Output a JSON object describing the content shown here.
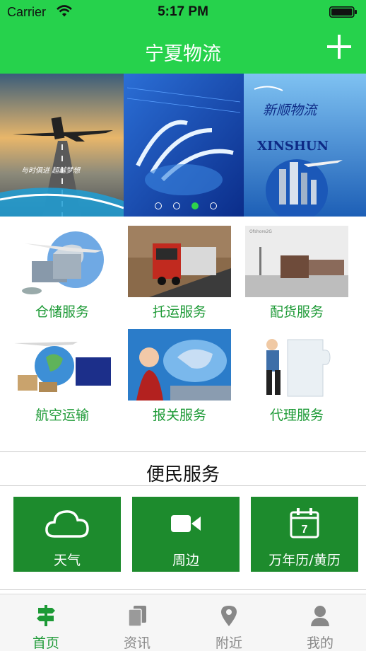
{
  "status_bar": {
    "carrier": "Carrier",
    "time": "5:17 PM"
  },
  "nav": {
    "title": "宁夏物流",
    "add_icon": "plus-icon"
  },
  "banner": {
    "left_caption": "与时俱进 超越梦想",
    "brand_cn": "新顺物流",
    "brand_en": "XINSHUN",
    "page_count": 4,
    "active_page": 3
  },
  "services": [
    {
      "label": "仓储服务",
      "image": "warehouse-globe"
    },
    {
      "label": "托运服务",
      "image": "truck-on-road"
    },
    {
      "label": "配货服务",
      "image": "train-freight",
      "image_caption": "Ofshore2G"
    },
    {
      "label": "航空运输",
      "image": "air-cargo-globe"
    },
    {
      "label": "报关服务",
      "image": "stewardess-world-map"
    },
    {
      "label": "代理服务",
      "image": "man-pushing-puzzle"
    }
  ],
  "convenience": {
    "title": "便民服务",
    "items": [
      {
        "label": "天气",
        "icon": "cloud-icon"
      },
      {
        "label": "周边",
        "icon": "video-camera-icon"
      },
      {
        "label": "万年历/黄历",
        "icon": "calendar-icon",
        "icon_text": "7"
      }
    ]
  },
  "tabs": [
    {
      "label": "首页",
      "icon": "signpost-icon",
      "active": true
    },
    {
      "label": "资讯",
      "icon": "documents-icon",
      "active": false
    },
    {
      "label": "附近",
      "icon": "map-pin-icon",
      "active": false
    },
    {
      "label": "我的",
      "icon": "user-icon",
      "active": false
    }
  ],
  "colors": {
    "header_green": "#26d24c",
    "label_green": "#1d9a36",
    "tile_green": "#1d8b2d",
    "tab_active": "#1d9a36",
    "tab_inactive": "#888888"
  }
}
